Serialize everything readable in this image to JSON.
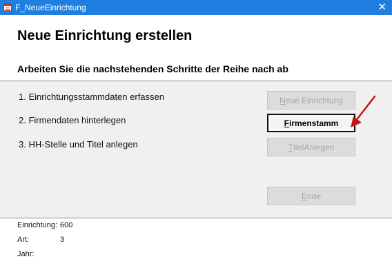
{
  "window": {
    "title": "F_NeueEinrichtung"
  },
  "header": {
    "title": "Neue Einrichtung erstellen",
    "subtitle": "Arbeiten Sie die nachstehenden Schritte der Reihe nach ab"
  },
  "steps": [
    {
      "label": "1. Einrichtungsstammdaten erfassen",
      "button": {
        "mnemonic": "N",
        "rest": "eue Einrichtung",
        "enabled": false
      }
    },
    {
      "label": "2. Firmendaten hinterlegen",
      "button": {
        "mnemonic": "F",
        "rest": "irmenstamm",
        "enabled": true
      }
    },
    {
      "label": "3. HH-Stelle und Titel anlegen",
      "button": {
        "mnemonic": "T",
        "rest": "itelAnlegen",
        "enabled": false
      }
    }
  ],
  "end_button": {
    "mnemonic": "E",
    "rest": "nde",
    "enabled": false
  },
  "footer": {
    "rows": [
      {
        "label": "Einrichtung:",
        "value": "600"
      },
      {
        "label": "Art:",
        "value": "3"
      },
      {
        "label": "Jahr:",
        "value": ""
      }
    ]
  },
  "colors": {
    "titlebar": "#1f7fe0",
    "detail_bg": "#f0f0f0",
    "arrow": "#c0141b"
  }
}
